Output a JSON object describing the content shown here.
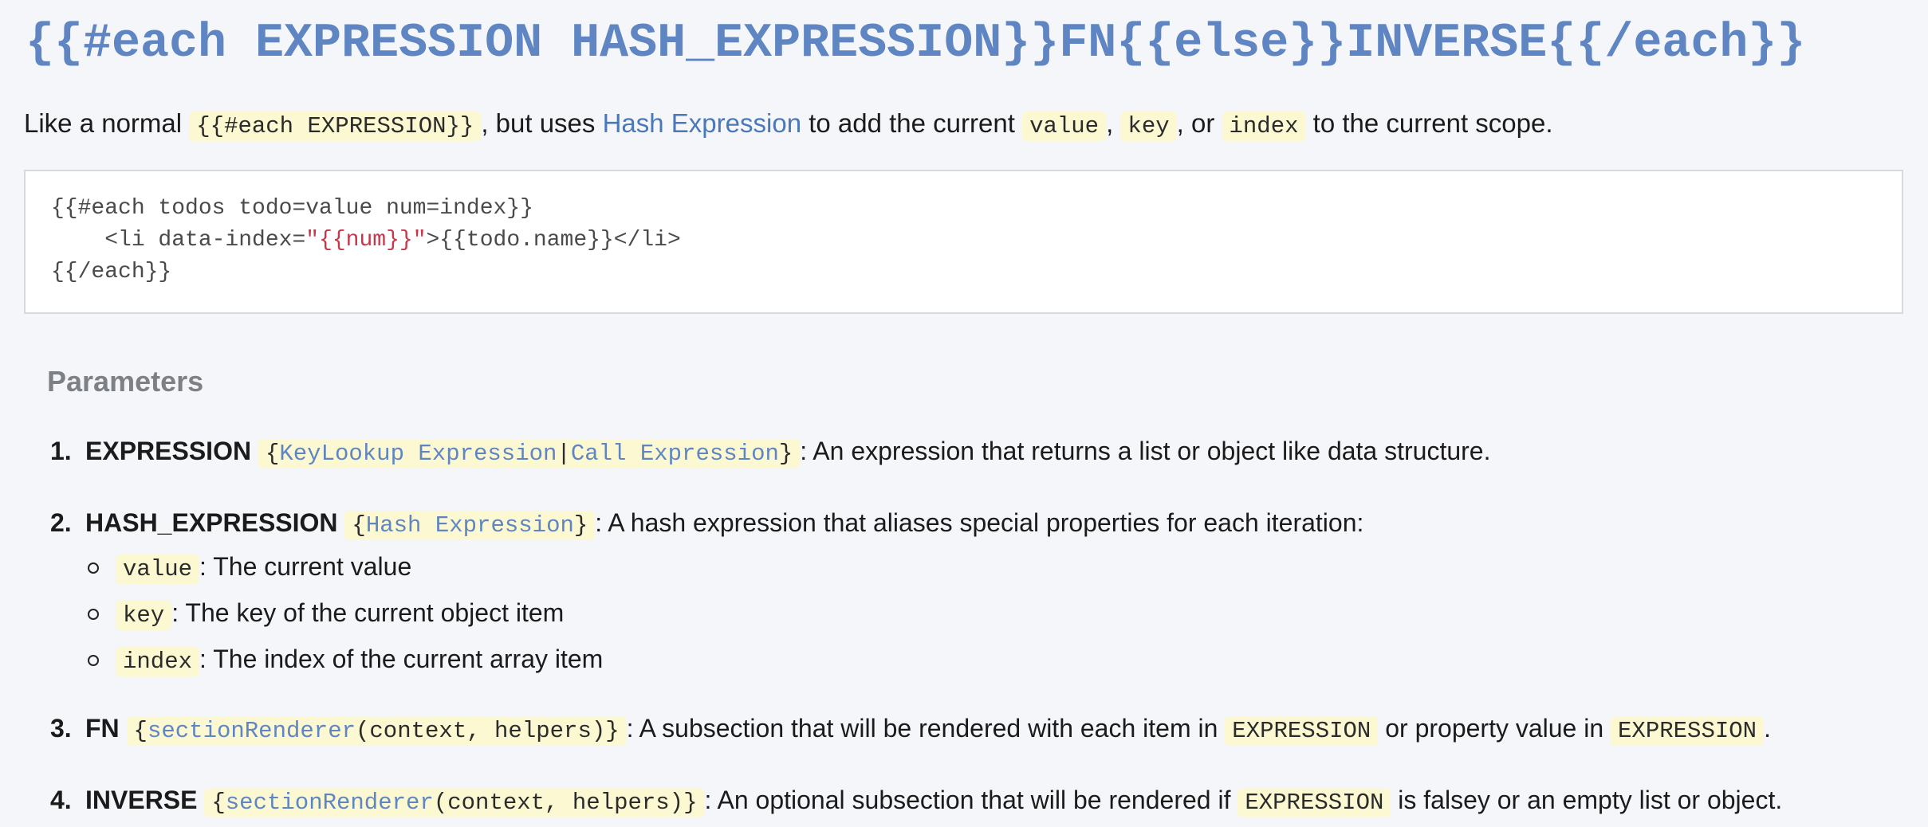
{
  "signature": "{{#each EXPRESSION HASH_EXPRESSION}}FN{{else}}INVERSE{{/each}}",
  "intro": {
    "t1": "Like a normal ",
    "code1": "{{#each EXPRESSION}}",
    "t2": ", but uses ",
    "link": "Hash Expression",
    "t3": " to add the current ",
    "code2": "value",
    "t4": ", ",
    "code3": "key",
    "t5": ", or ",
    "code4": "index",
    "t6": " to the current scope."
  },
  "code_example": {
    "line1": "{{#each todos todo=value num=index}}",
    "line2_pre": "    <li data-index=",
    "line2_str": "\"{{num}}\"",
    "line2_post": ">{{todo.name}}</li>",
    "line3": "{{/each}}"
  },
  "parameters": {
    "title": "Parameters",
    "items": [
      {
        "num": "1.",
        "name": "EXPRESSION",
        "type_open": "{",
        "type_a": "KeyLookup Expression",
        "type_sep": "|",
        "type_b": "Call Expression",
        "type_close": "}",
        "desc": ": An expression that returns a list or object like data structure."
      },
      {
        "num": "2.",
        "name": "HASH_EXPRESSION",
        "type_open": "{",
        "type_a": "Hash Expression",
        "type_close": "}",
        "desc": ": A hash expression that aliases special properties for each iteration:",
        "sub": [
          {
            "code": "value",
            "desc": ": The current value"
          },
          {
            "code": "key",
            "desc": ": The key of the current object item"
          },
          {
            "code": "index",
            "desc": ": The index of the current array item"
          }
        ]
      },
      {
        "num": "3.",
        "name": "FN",
        "type_open": "{",
        "type_a": "sectionRenderer",
        "type_rest": "(context, helpers)}",
        "desc1": ": A subsection that will be rendered with each item in ",
        "code1": "EXPRESSION",
        "desc2": " or property value in ",
        "code2": "EXPRESSION",
        "desc3": "."
      },
      {
        "num": "4.",
        "name": "INVERSE",
        "type_open": "{",
        "type_a": "sectionRenderer",
        "type_rest": "(context, helpers)}",
        "desc1": ": An optional subsection that will be rendered if ",
        "code1": "EXPRESSION",
        "desc2": " is falsey or an empty list or object."
      }
    ]
  },
  "colors": {
    "heading": "#5f86c2",
    "link": "#4b78b9",
    "code_bg": "#fbf8d2",
    "string": "#c7364b",
    "page_bg": "#f5f6fa"
  }
}
